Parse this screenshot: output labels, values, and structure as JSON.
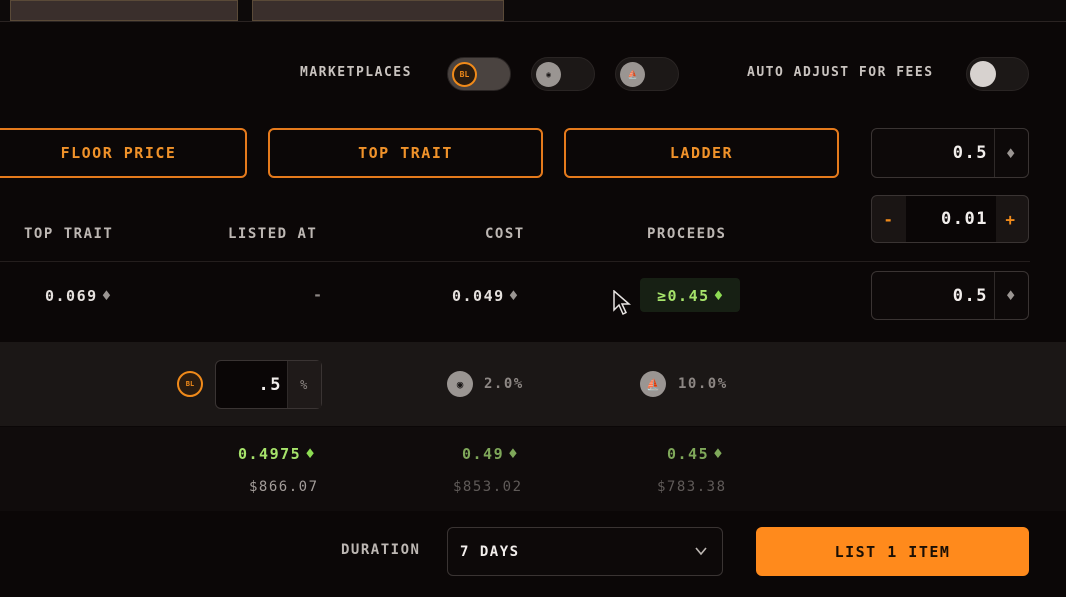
{
  "marketplaces": {
    "label": "MARKETPLACES",
    "items": [
      {
        "name": "blur-icon",
        "glyph": "BL\nUR",
        "enabled": true
      },
      {
        "name": "opensea-eye-icon",
        "glyph": "◉",
        "enabled": false
      },
      {
        "name": "boat-icon",
        "glyph": "⛵",
        "enabled": false
      }
    ]
  },
  "auto_adjust": {
    "label": "AUTO ADJUST FOR FEES",
    "enabled": false
  },
  "price_buttons": {
    "floor": "FLOOR PRICE",
    "top_trait": "TOP TRAIT",
    "ladder": "LADDER"
  },
  "price_input": {
    "value": "0.5",
    "icon": "eth-icon"
  },
  "stepper": {
    "minus": "-",
    "value": "0.01",
    "plus": "+"
  },
  "table": {
    "headers": {
      "top_trait": "TOP TRAIT",
      "listed_at": "LISTED AT",
      "cost": "COST",
      "proceeds": "PROCEEDS"
    },
    "row": {
      "top_trait": "0.069",
      "listed_at": "-",
      "cost": "0.049",
      "proceeds": "≥0.45",
      "input": "0.5"
    }
  },
  "fees": {
    "blur_input": ".5",
    "blur_unit": "%",
    "opensea_fee": "2.0%",
    "boat_fee": "10.0%"
  },
  "totals": {
    "blur": {
      "eth": "0.4975",
      "usd": "$866.07"
    },
    "opensea": {
      "eth": "0.49",
      "usd": "$853.02"
    },
    "boat": {
      "eth": "0.45",
      "usd": "$783.38"
    }
  },
  "duration": {
    "label": "DURATION",
    "value": "7 DAYS"
  },
  "list_button": "LIST 1 ITEM",
  "colors": {
    "accent": "#ff8a1c",
    "green": "#a6e36b",
    "background": "#0b0707"
  }
}
